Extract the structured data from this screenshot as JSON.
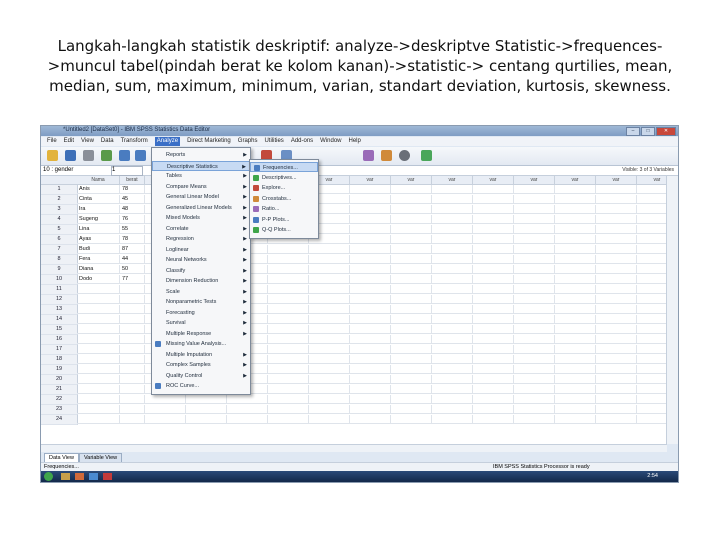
{
  "caption": {
    "line1": "Langkah-langkah statistik deskriptif: analyze->deskriptve Statistic->frequences-",
    "line2": ">muncul tabel(pindah berat ke kolom kanan)->statistic-> centang qurtilies, mean,",
    "line3": "median, sum, maximum, minimum, varian, standart deviation, kurtosis, skewness."
  },
  "window": {
    "title": "*Untitled2 [DataSet0] - IBM SPSS Statistics Data Editor"
  },
  "menubar": [
    "File",
    "Edit",
    "View",
    "Data",
    "Transform",
    "Analyze",
    "Direct Marketing",
    "Graphs",
    "Utilities",
    "Add-ons",
    "Window",
    "Help"
  ],
  "refbar": {
    "cell": "10 : gender",
    "value": "1",
    "visible": "Visible: 3 of 3 Variables"
  },
  "columns": [
    "Nama",
    "berat",
    "var",
    "var",
    "var",
    "var",
    "var",
    "var",
    "var",
    "var",
    "var",
    "var",
    "var",
    "var",
    "var",
    "var"
  ],
  "rows": [
    {
      "n": "1",
      "nama": "Anis",
      "berat": "78"
    },
    {
      "n": "2",
      "nama": "Cinta",
      "berat": "45"
    },
    {
      "n": "3",
      "nama": "Ira",
      "berat": "48"
    },
    {
      "n": "4",
      "nama": "Sugeng",
      "berat": "76"
    },
    {
      "n": "5",
      "nama": "Lina",
      "berat": "55"
    },
    {
      "n": "6",
      "nama": "Ayas",
      "berat": "78"
    },
    {
      "n": "7",
      "nama": "Budi",
      "berat": "87"
    },
    {
      "n": "8",
      "nama": "Fera",
      "berat": "44"
    },
    {
      "n": "9",
      "nama": "Diana",
      "berat": "50"
    },
    {
      "n": "10",
      "nama": "Dodo",
      "berat": "77"
    },
    {
      "n": "11"
    },
    {
      "n": "12"
    },
    {
      "n": "13"
    },
    {
      "n": "14"
    },
    {
      "n": "15"
    },
    {
      "n": "16"
    },
    {
      "n": "17"
    },
    {
      "n": "18"
    },
    {
      "n": "19"
    },
    {
      "n": "20"
    },
    {
      "n": "21"
    },
    {
      "n": "22"
    },
    {
      "n": "23"
    },
    {
      "n": "24"
    }
  ],
  "analyze_menu": [
    {
      "label": "Reports",
      "sub": true
    },
    {
      "label": "Descriptive Statistics",
      "sub": true,
      "highlight": true
    },
    {
      "label": "Tables",
      "sub": true
    },
    {
      "label": "Compare Means",
      "sub": true
    },
    {
      "label": "General Linear Model",
      "sub": true
    },
    {
      "label": "Generalized Linear Models",
      "sub": true
    },
    {
      "label": "Mixed Models",
      "sub": true
    },
    {
      "label": "Correlate",
      "sub": true
    },
    {
      "label": "Regression",
      "sub": true
    },
    {
      "label": "Loglinear",
      "sub": true
    },
    {
      "label": "Neural Networks",
      "sub": true
    },
    {
      "label": "Classify",
      "sub": true
    },
    {
      "label": "Dimension Reduction",
      "sub": true
    },
    {
      "label": "Scale",
      "sub": true
    },
    {
      "label": "Nonparametric Tests",
      "sub": true
    },
    {
      "label": "Forecasting",
      "sub": true
    },
    {
      "label": "Survival",
      "sub": true
    },
    {
      "label": "Multiple Response",
      "sub": true
    },
    {
      "label": "Missing Value Analysis...",
      "sub": false
    },
    {
      "label": "Multiple Imputation",
      "sub": true
    },
    {
      "label": "Complex Samples",
      "sub": true
    },
    {
      "label": "Quality Control",
      "sub": true
    },
    {
      "label": "ROC Curve...",
      "sub": false
    }
  ],
  "descriptive_submenu": [
    "Frequencies...",
    "Descriptives...",
    "Explore...",
    "Crosstabs...",
    "Ratio...",
    "P-P Plots...",
    "Q-Q Plots..."
  ],
  "tabs": {
    "data_view": "Data View",
    "variable_view": "Variable View"
  },
  "status": {
    "left": "Frequencies...",
    "right": "IBM SPSS Statistics Processor is ready"
  },
  "taskbar": {
    "clock": "2:54"
  },
  "colors": {
    "menu_highlight": "#c7daf3",
    "titlebar": "#7e9cc3",
    "taskbar": "#1c3560"
  }
}
